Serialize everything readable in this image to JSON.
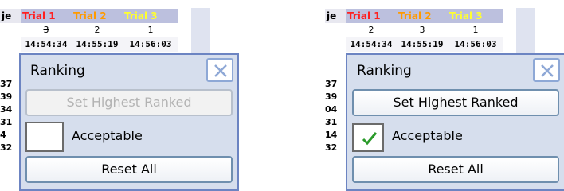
{
  "left": {
    "table": {
      "row_label": "je",
      "headers": [
        "Trial 1",
        "Trial 2",
        "Trial 3"
      ],
      "ranks": [
        "3",
        "2",
        "1"
      ],
      "times": [
        "14:54:34",
        "14:55:19",
        "14:56:03"
      ],
      "side_numbers": [
        "37",
        "39",
        "34",
        "31",
        "4",
        "32"
      ]
    },
    "dialog": {
      "title": "Ranking",
      "set_highest_label": "Set Highest Ranked",
      "set_highest_enabled": false,
      "acceptable_label": "Acceptable",
      "acceptable_checked": false,
      "reset_label": "Reset All"
    }
  },
  "right": {
    "table": {
      "row_label": "je",
      "headers": [
        "Trial 1",
        "Trial 2",
        "Trial 3"
      ],
      "ranks": [
        "2",
        "3",
        "1"
      ],
      "times": [
        "14:54:34",
        "14:55:19",
        "14:56:03"
      ],
      "side_numbers": [
        "37",
        "39",
        "04",
        "31",
        "14",
        "32"
      ]
    },
    "dialog": {
      "title": "Ranking",
      "set_highest_label": "Set Highest Ranked",
      "set_highest_enabled": true,
      "acceptable_label": "Acceptable",
      "acceptable_checked": true,
      "reset_label": "Reset All"
    }
  },
  "colors": {
    "trial1": "#ff2020",
    "trial2": "#ff9a00",
    "trial3": "#ffff30",
    "dialog_bg": "#d6deed",
    "checkmark": "#2a9a2a"
  }
}
